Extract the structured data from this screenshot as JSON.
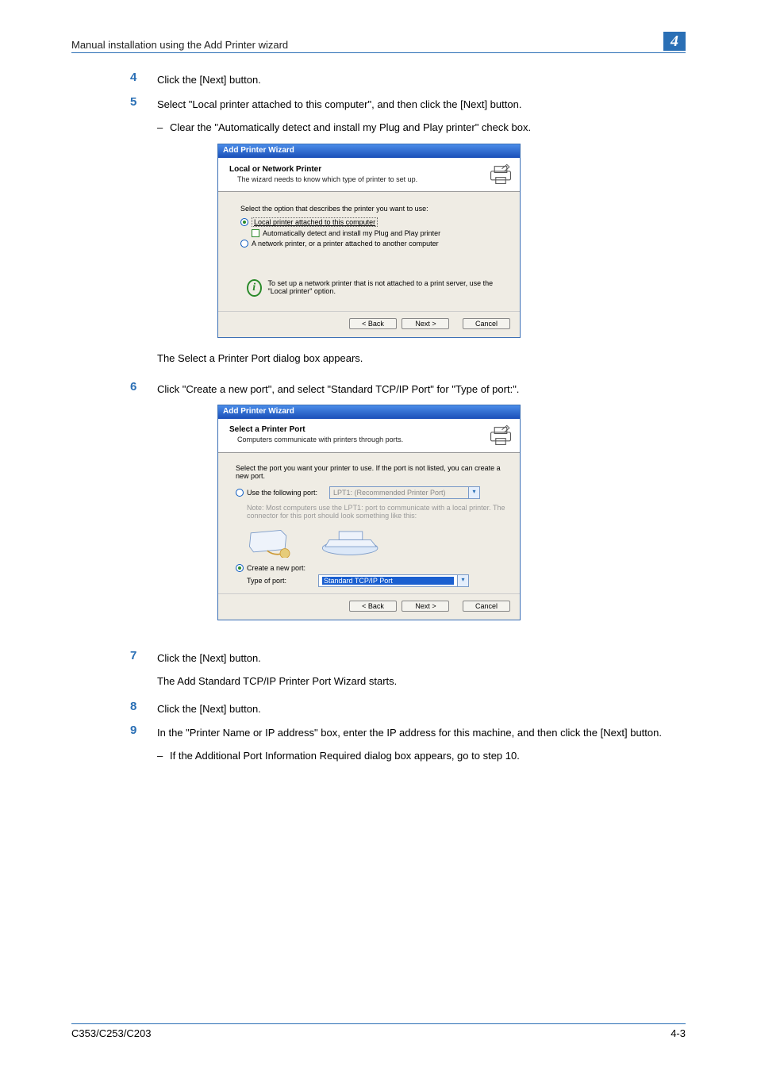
{
  "header": {
    "title": "Manual installation using the Add Printer wizard",
    "chapter": "4"
  },
  "steps": {
    "s4": {
      "text": "Click the [Next] button."
    },
    "s5": {
      "text": "Select \"Local printer attached to this computer\", and then click the [Next] button.",
      "bullet": "Clear the \"Automatically detect and install my Plug and Play printer\" check box."
    },
    "s5_after": "The Select a Printer Port dialog box appears.",
    "s6": {
      "text": "Click \"Create a new port\", and select \"Standard TCP/IP Port\" for \"Type of port:\"."
    },
    "s7": {
      "text": "Click the [Next] button.",
      "after": "The Add Standard TCP/IP Printer Port Wizard starts."
    },
    "s8": {
      "text": "Click the [Next] button."
    },
    "s9": {
      "text": "In the \"Printer Name or IP address\" box, enter the IP address for this machine, and then click the [Next] button.",
      "bullet": "If the Additional Port Information Required dialog box appears, go to step 10."
    }
  },
  "dialog1": {
    "title": "Add Printer Wizard",
    "head_title": "Local or Network Printer",
    "head_sub": "The wizard needs to know which type of printer to set up.",
    "intro": "Select the option that describes the printer you want to use:",
    "opt_local": "Local printer attached to this computer",
    "opt_auto": "Automatically detect and install my Plug and Play printer",
    "opt_net": "A network printer, or a printer attached to another computer",
    "info": "To set up a network printer that is not attached to a print server, use the \"Local printer\" option.",
    "back": "< Back",
    "next": "Next >",
    "cancel": "Cancel"
  },
  "dialog2": {
    "title": "Add Printer Wizard",
    "head_title": "Select a Printer Port",
    "head_sub": "Computers communicate with printers through ports.",
    "intro": "Select the port you want your printer to use. If the port is not listed, you can create a new port.",
    "opt_use": "Use the following port:",
    "combo_use": "LPT1: (Recommended Printer Port)",
    "note": "Note: Most computers use the LPT1: port to communicate with a local printer. The connector for this port should look something like this:",
    "opt_create": "Create a new port:",
    "type_label": "Type of port:",
    "combo_type": "Standard TCP/IP Port",
    "back": "< Back",
    "next": "Next >",
    "cancel": "Cancel"
  },
  "footer": {
    "left": "C353/C253/C203",
    "right": "4-3"
  }
}
